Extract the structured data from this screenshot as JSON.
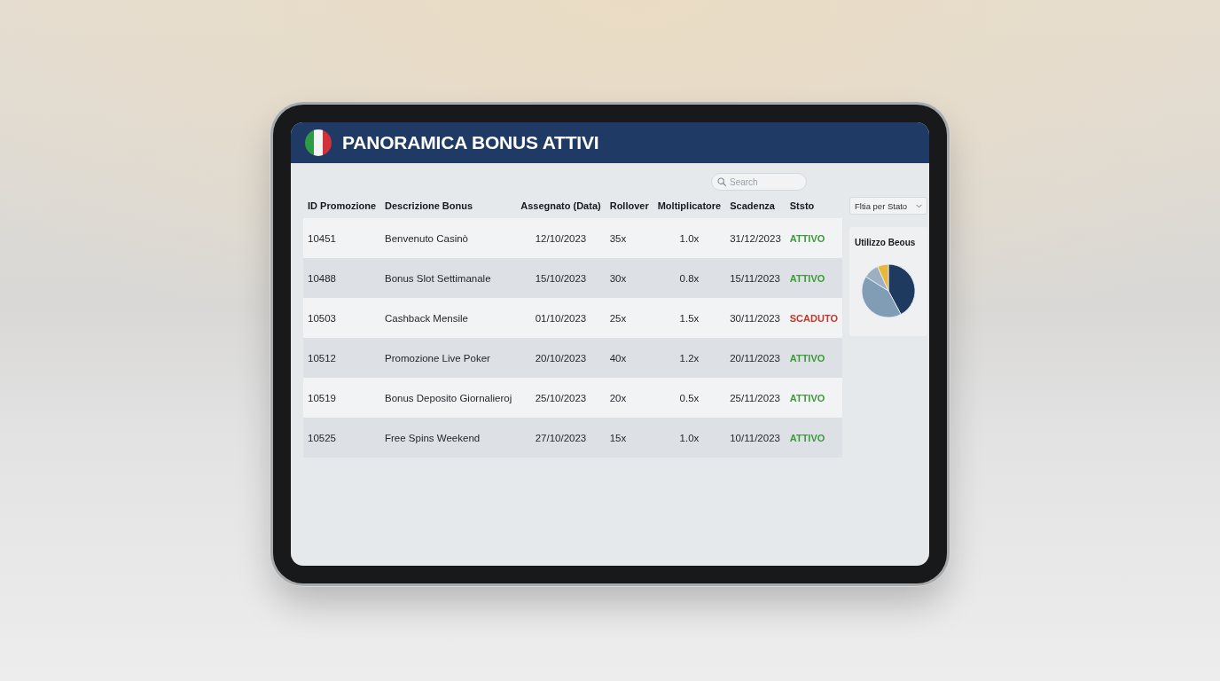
{
  "header": {
    "title": "PANORAMICA BONUS ATTIVI"
  },
  "search": {
    "placeholder": "Search"
  },
  "table": {
    "columns": [
      "ID Promozione",
      "Descrizione Bonus",
      "Assegnato (Data)",
      "Rollover",
      "Moltiplicatore",
      "Scadenza",
      "Ststo"
    ],
    "rows": [
      {
        "cells": [
          "10451",
          "Benvenuto Casinò",
          "12/10/2023",
          "35x",
          "1.0x",
          "31/12/2023"
        ],
        "status": "ATTIVO",
        "color": "#3e9a3a"
      },
      {
        "cells": [
          "10488",
          "Bonus Slot Settimanale",
          "15/10/2023",
          "30x",
          "0.8x",
          "15/11/2023"
        ],
        "status": "ATTIVO",
        "color": "#3e9a3a"
      },
      {
        "cells": [
          "10503",
          "Cashback Mensile",
          "01/10/2023",
          "25x",
          "1.5x",
          "30/11/2023"
        ],
        "status": "SCADUTO",
        "color": "#c0392b"
      },
      {
        "cells": [
          "10512",
          "Promozione Live Poker",
          "20/10/2023",
          "40x",
          "1.2x",
          "20/11/2023"
        ],
        "status": "ATTIVO",
        "color": "#3e9a3a"
      },
      {
        "cells": [
          "10519",
          "Bonus Deposito Giornalieroj",
          "25/10/2023",
          "20x",
          "0.5x",
          "25/11/2023"
        ],
        "status": "ATTIVO",
        "color": "#3e9a3a"
      },
      {
        "cells": [
          "10525",
          "Free Spins Weekend",
          "27/10/2023",
          "15x",
          "1.0x",
          "10/11/2023"
        ],
        "status": "ATTIVO",
        "color": "#3e9a3a"
      }
    ]
  },
  "filter": {
    "label": "Fltia per Stato"
  },
  "chart_card": {
    "title": "Utilizzo Beous"
  }
}
